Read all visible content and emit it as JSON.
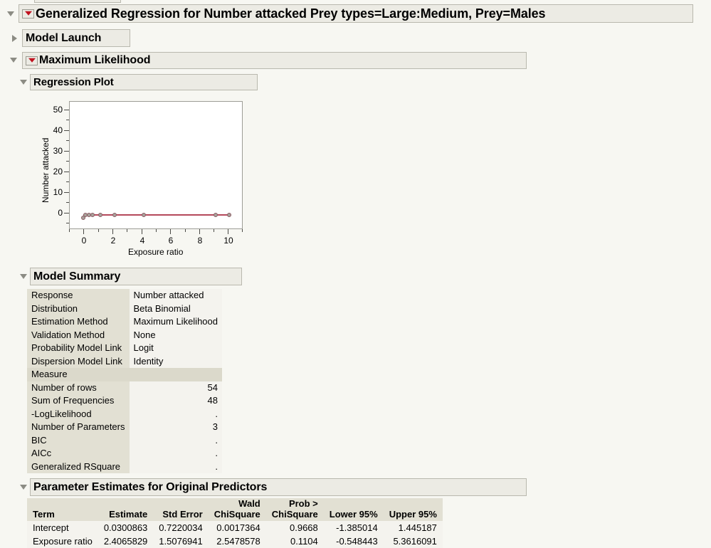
{
  "window": {
    "background_color": "#f7f7f2",
    "accent_red": "#c0121f",
    "panel_bg": "#ecebe4",
    "label_cell_bg": "#e2e0d3",
    "value_cell_bg": "#f4f3ee"
  },
  "outline": {
    "report_title": "Generalized Regression for Number attacked Prey types=Large:Medium, Prey=Males",
    "model_launch_title": "Model Launch",
    "maximum_likelihood_title": "Maximum Likelihood",
    "regression_plot_title": "Regression Plot",
    "model_summary_title": "Model Summary",
    "parameter_estimates_title": "Parameter Estimates for Original Predictors"
  },
  "chart_data": {
    "type": "scatter",
    "title": "Regression Plot",
    "xlabel": "Exposure ratio",
    "ylabel": "Number attacked",
    "xlim": [
      -1,
      11
    ],
    "ylim": [
      -4,
      54
    ],
    "xticks": [
      0,
      2,
      4,
      6,
      8,
      10
    ],
    "yticks": [
      0,
      10,
      20,
      30,
      40,
      50
    ],
    "xtick_labels": [
      "0",
      "2",
      "4",
      "6",
      "8",
      "10"
    ],
    "ytick_labels": [
      "0",
      "10",
      "20",
      "30",
      "40",
      "50"
    ],
    "grid": false,
    "legend": "none",
    "point_color": "#a8a29b",
    "line_color": "#b5485a",
    "series": [
      {
        "name": "Observed",
        "x": [
          0.1,
          0.2,
          0.4,
          0.5,
          1.0,
          2.0,
          4.0,
          9.0,
          10.0
        ],
        "y": [
          0.6,
          1.1,
          1.2,
          1.2,
          1.2,
          1.2,
          1.2,
          1.2,
          1.2
        ]
      }
    ],
    "fit_line": {
      "name": "Predicted",
      "x": [
        0.1,
        10.0
      ],
      "y": [
        0.9,
        1.25
      ]
    }
  },
  "model_summary": {
    "rows": [
      {
        "label": "Response",
        "value": "Number attacked"
      },
      {
        "label": "Distribution",
        "value": "Beta Binomial"
      },
      {
        "label": "Estimation Method",
        "value": "Maximum Likelihood"
      },
      {
        "label": "Validation Method",
        "value": "None"
      },
      {
        "label": "Probability Model Link",
        "value": "Logit"
      },
      {
        "label": "Dispersion Model Link",
        "value": "Identity"
      }
    ],
    "measure_header": "Measure",
    "measure_header_value": "",
    "measures": [
      {
        "label": "Number of rows",
        "value": "54"
      },
      {
        "label": "Sum of Frequencies",
        "value": "48"
      },
      {
        "label": "-LogLikelihood",
        "value": "."
      },
      {
        "label": "Number of Parameters",
        "value": "3"
      },
      {
        "label": "BIC",
        "value": "."
      },
      {
        "label": "AICc",
        "value": "."
      },
      {
        "label": "Generalized RSquare",
        "value": "."
      }
    ]
  },
  "parameter_estimates": {
    "headers": [
      {
        "line1": "",
        "line2": "Term",
        "align": "left"
      },
      {
        "line1": "",
        "line2": "Estimate",
        "align": "right"
      },
      {
        "line1": "",
        "line2": "Std Error",
        "align": "right"
      },
      {
        "line1": "Wald",
        "line2": "ChiSquare",
        "align": "right"
      },
      {
        "line1": "Prob >",
        "line2": "ChiSquare",
        "align": "right"
      },
      {
        "line1": "",
        "line2": "Lower 95%",
        "align": "right"
      },
      {
        "line1": "",
        "line2": "Upper 95%",
        "align": "right"
      }
    ],
    "rows": [
      {
        "term": "Intercept",
        "estimate": "0.0300863",
        "std_error": "0.7220034",
        "wald_chisquare": "0.0017364",
        "prob_chisquare": "0.9668",
        "lower95": "-1.385014",
        "upper95": "1.445187"
      },
      {
        "term": "Exposure ratio",
        "estimate": "2.4065829",
        "std_error": "1.5076941",
        "wald_chisquare": "2.5478578",
        "prob_chisquare": "0.1104",
        "lower95": "-0.548443",
        "upper95": "5.3616091"
      }
    ]
  }
}
